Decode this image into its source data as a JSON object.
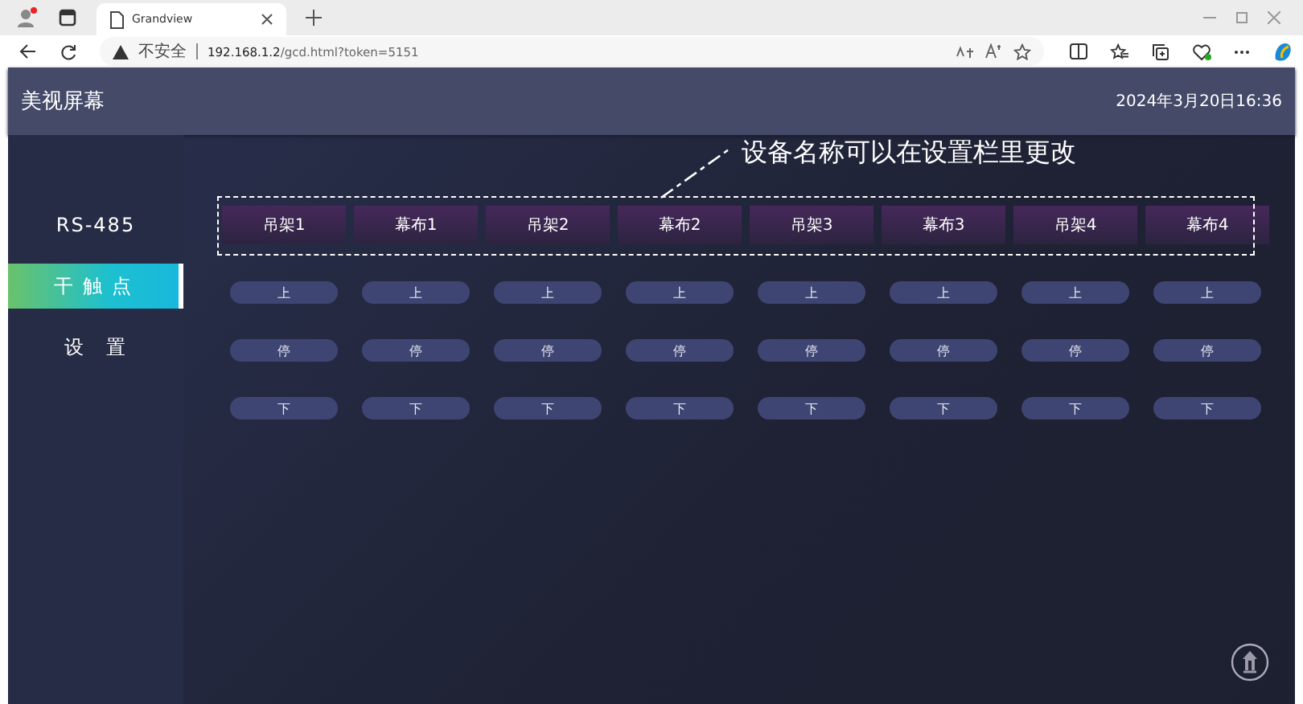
{
  "browser": {
    "tab_title": "Grandview",
    "security": "不安全",
    "url_host": "192.168.1.2",
    "url_path": "/gcd.html?token=5151"
  },
  "app": {
    "title": "美视屏幕",
    "datetime": "2024年3月20日16:36"
  },
  "nav": [
    {
      "label": "RS-485",
      "selected": false
    },
    {
      "label": "干 触 点",
      "selected": true
    },
    {
      "label": "设　置",
      "selected": false
    }
  ],
  "annotation": "设备名称可以在设置栏里更改",
  "devices": [
    {
      "name": "吊架1",
      "buttons": [
        "上",
        "停",
        "下"
      ]
    },
    {
      "name": "幕布1",
      "buttons": [
        "上",
        "停",
        "下"
      ]
    },
    {
      "name": "吊架2",
      "buttons": [
        "上",
        "停",
        "下"
      ]
    },
    {
      "name": "幕布2",
      "buttons": [
        "上",
        "停",
        "下"
      ]
    },
    {
      "name": "吊架3",
      "buttons": [
        "上",
        "停",
        "下"
      ]
    },
    {
      "name": "幕布3",
      "buttons": [
        "上",
        "停",
        "下"
      ]
    },
    {
      "name": "吊架4",
      "buttons": [
        "上",
        "停",
        "下"
      ]
    },
    {
      "name": "幕布4",
      "buttons": [
        "上",
        "停",
        "下"
      ]
    }
  ]
}
